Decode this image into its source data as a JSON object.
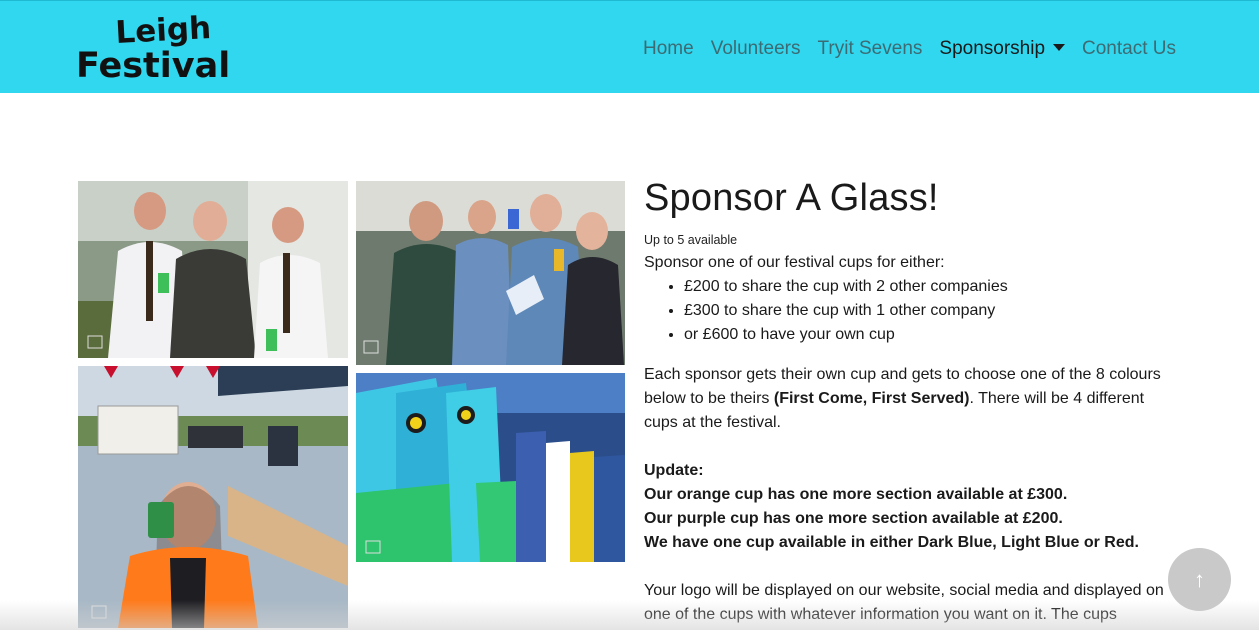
{
  "brand": {
    "line1": "Leigh",
    "line2": "Festival"
  },
  "nav": [
    {
      "label": "Home"
    },
    {
      "label": "Volunteers"
    },
    {
      "label": "Tryit Sevens"
    },
    {
      "label": "Sponsorship"
    },
    {
      "label": "Contact Us"
    }
  ],
  "colors": {
    "navbar": "#30d7ef",
    "accent": "#30d7ef"
  },
  "main": {
    "title": "Sponsor A Glass!",
    "availability": "Up to 5 available",
    "intro": "Sponsor one of our festival cups for either:",
    "options": [
      "£200 to share the cup with 2 other companies",
      "£300 to share the cup with 1 other company",
      "or £600 to have your own cup"
    ],
    "colours_text_a": "Each sponsor gets their own cup and gets to choose one of the 8 colours below to be theirs ",
    "colours_text_bold": "(First Come, First Served)",
    "colours_text_b": ". There will be 4 different cups at the festival.",
    "update_heading": "Update:",
    "update_lines": [
      "Our orange cup has one more section available at £300.",
      "Our purple cup has one more section available at £200.",
      "We have one cup available in either Dark Blue, Light Blue or Red."
    ],
    "logo_text": "Your logo will be displayed on our website, social media and displayed on one of the cups with whatever information you want on it. The cups"
  },
  "back_to_top": {
    "icon": "arrow-up-icon",
    "glyph": "↑"
  }
}
